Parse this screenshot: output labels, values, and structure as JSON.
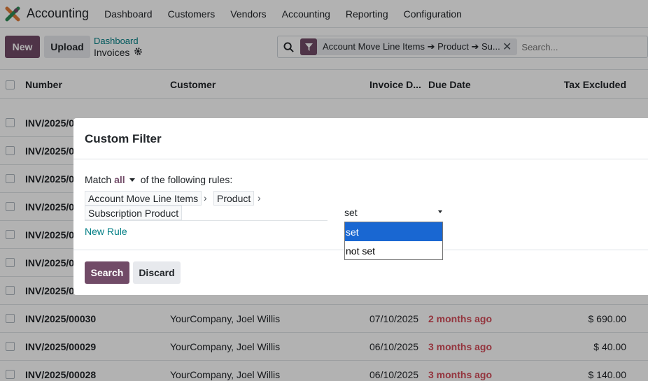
{
  "app": {
    "title": "Accounting"
  },
  "nav": [
    "Dashboard",
    "Customers",
    "Vendors",
    "Accounting",
    "Reporting",
    "Configuration"
  ],
  "toolbar": {
    "new_label": "New",
    "upload_label": "Upload"
  },
  "breadcrumb": {
    "parent": "Dashboard",
    "current": "Invoices"
  },
  "search": {
    "facet": "Account Move Line Items ➔ Product ➔ Su...",
    "placeholder": "Search..."
  },
  "table": {
    "headers": {
      "number": "Number",
      "customer": "Customer",
      "invoice_date": "Invoice D...",
      "due_date": "Due Date",
      "tax_excluded": "Tax Excluded"
    },
    "partial_rows": [
      {
        "number": "INV/2025/0"
      },
      {
        "number": "INV/2025/0"
      },
      {
        "number": "INV/2025/0"
      },
      {
        "number": "INV/2025/0"
      },
      {
        "number": "INV/2025/0"
      },
      {
        "number": "INV/2025/0"
      },
      {
        "number": "INV/2025/0"
      }
    ],
    "rows": [
      {
        "number": "INV/2025/00030",
        "customer": "YourCompany, Joel Willis",
        "invoice_date": "07/10/2025",
        "due": "2 months ago",
        "tax": "$ 690.00"
      },
      {
        "number": "INV/2025/00029",
        "customer": "YourCompany, Joel Willis",
        "invoice_date": "06/10/2025",
        "due": "3 months ago",
        "tax": "$ 40.00"
      },
      {
        "number": "INV/2025/00028",
        "customer": "YourCompany, Joel Willis",
        "invoice_date": "06/10/2025",
        "due": "3 months ago",
        "tax": "$ 140.00"
      }
    ]
  },
  "modal": {
    "title": "Custom Filter",
    "match_prefix": "Match",
    "match_value": "all",
    "match_suffix": "of the following rules:",
    "path": [
      "Account Move Line Items",
      "Product",
      "Subscription Product"
    ],
    "operator_value": "set",
    "operator_options": [
      "set",
      "not set"
    ],
    "new_rule_label": "New Rule",
    "search_label": "Search",
    "discard_label": "Discard"
  },
  "colors": {
    "brand": "#714b67",
    "link": "#017e84",
    "danger": "#d44c59",
    "select_highlight": "#1967d2"
  }
}
